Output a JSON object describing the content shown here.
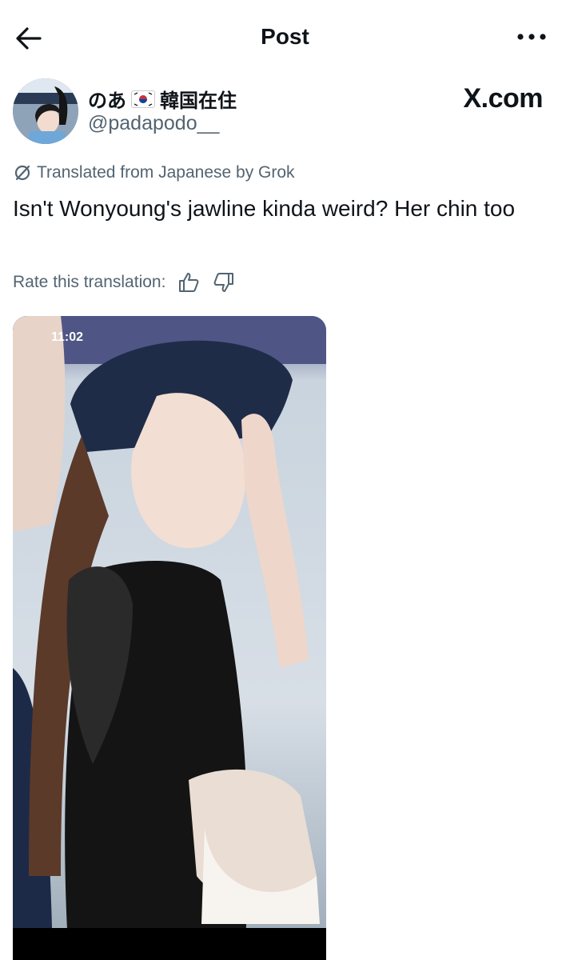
{
  "header": {
    "title": "Post"
  },
  "author": {
    "name": "のあ",
    "name_suffix": "韓国在住",
    "handle": "@padapodo__"
  },
  "brand": {
    "watermark": "X.com"
  },
  "post": {
    "translation_note": "Translated from Japanese by Grok",
    "text": "Isn't Wonyoung's jawline kinda weird? Her chin too",
    "rate_label": "Rate this translation:"
  },
  "media": {
    "timestamp": "11:02"
  },
  "colors": {
    "text": "#0f1419",
    "secondary": "#536471",
    "background": "#ffffff"
  },
  "icons": [
    "back-arrow-icon",
    "more-icon",
    "grok-icon",
    "thumbs-up-icon",
    "thumbs-down-icon",
    "korea-flag-icon"
  ]
}
